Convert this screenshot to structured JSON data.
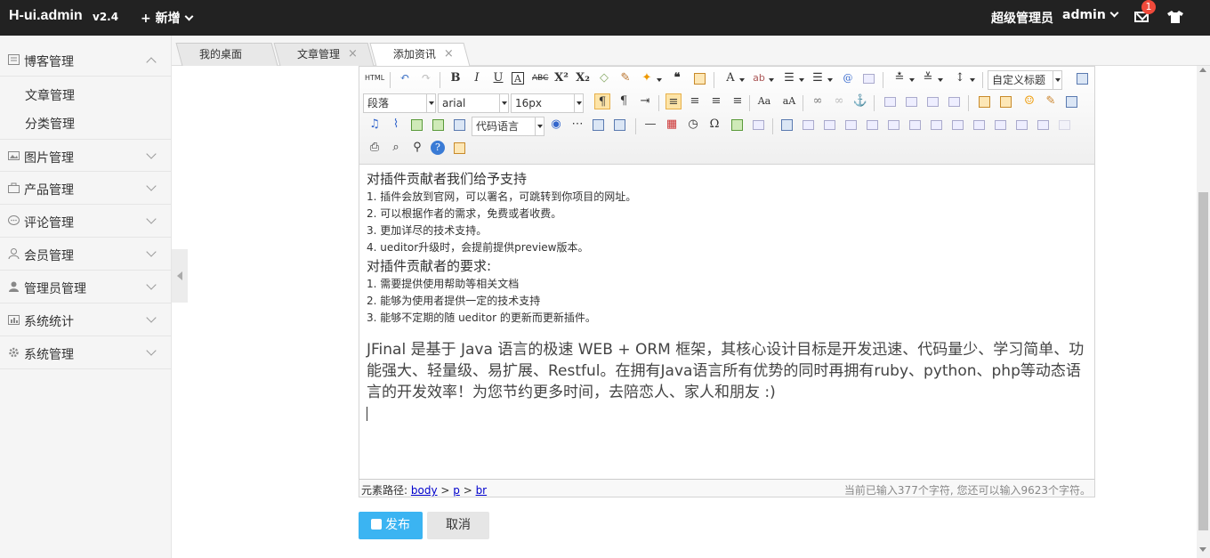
{
  "app": {
    "logo": "H-ui.admin",
    "version": "v2.4",
    "new_label": "新增"
  },
  "user": {
    "role": "超级管理员",
    "name": "admin",
    "notifications": "1"
  },
  "sidebar": {
    "groups": [
      {
        "label": "博客管理",
        "icon": "doc-icon",
        "expanded": true,
        "items": [
          "文章管理",
          "分类管理"
        ]
      },
      {
        "label": "图片管理",
        "icon": "image-icon"
      },
      {
        "label": "产品管理",
        "icon": "bag-icon"
      },
      {
        "label": "评论管理",
        "icon": "comment-icon"
      },
      {
        "label": "会员管理",
        "icon": "user-icon"
      },
      {
        "label": "管理员管理",
        "icon": "admin-icon"
      },
      {
        "label": "系统统计",
        "icon": "chart-icon"
      },
      {
        "label": "系统管理",
        "icon": "gear-icon"
      }
    ]
  },
  "tabs": [
    {
      "label": "我的桌面"
    },
    {
      "label": "文章管理"
    },
    {
      "label": "添加资讯"
    }
  ],
  "editor": {
    "toolbar": {
      "html_label": "HTML",
      "custom_title": "自定义标题",
      "paragraph": "段落",
      "font_family": "arial",
      "font_size": "16px",
      "code_language": "代码语言"
    },
    "content": {
      "heading1": "对插件贡献者我们给予支持",
      "list1": [
        "1. 插件会放到官网，可以署名，可跳转到你项目的网址。",
        "2. 可以根据作者的需求，免费或者收费。",
        "3. 更加详尽的技术支持。",
        "4. ueditor升级时，会提前提供preview版本。"
      ],
      "heading2": "对插件贡献者的要求:",
      "list2": [
        "1. 需要提供使用帮助等相关文档",
        "2. 能够为使用者提供一定的技术支持",
        "3. 能够不定期的随 ueditor 的更新而更新插件。"
      ],
      "paragraph_big": "JFinal 是基于 Java 语言的极速 WEB + ORM 框架，其核心设计目标是开发迅速、代码量少、学习简单、功能强大、轻量级、易扩展、Restful。在拥有Java语言所有优势的同时再拥有ruby、python、php等动态语言的开发效率！为您节约更多时间，去陪恋人、家人和朋友 :)"
    },
    "status": {
      "path_label": "元素路径:",
      "path": [
        "body",
        "p",
        "br"
      ],
      "word_count": "当前已输入377个字符, 您还可以输入9623个字符。"
    }
  },
  "actions": {
    "publish": "发布",
    "cancel": "取消"
  },
  "colors": {
    "topbar": "#222222",
    "publish": "#3bb4f2",
    "badge": "#f04a3b"
  }
}
